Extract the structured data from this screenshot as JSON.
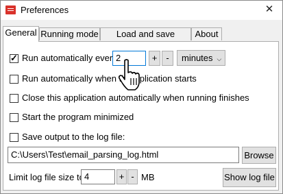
{
  "window": {
    "title": "Preferences",
    "close_glyph": "✕"
  },
  "tabs": [
    {
      "label": "General"
    },
    {
      "label": "Running mode"
    },
    {
      "label": "Load and save settings"
    },
    {
      "label": "About"
    }
  ],
  "general": {
    "run_every": {
      "label": "Run automatically every",
      "value": "2",
      "plus": "+",
      "minus": "-",
      "unit": "minutes",
      "checked": true
    },
    "run_on_start": {
      "label": "Run automatically when th",
      "label_tail": "pplication starts",
      "checked": false
    },
    "close_when_done": {
      "label": "Close this application automatically when running finishes",
      "checked": false
    },
    "start_minimized": {
      "label": "Start the program minimized",
      "checked": false
    },
    "save_log": {
      "label": "Save output to the log file:",
      "checked": false
    },
    "log_path": {
      "value": "C:\\Users\\Test\\email_parsing_log.html"
    },
    "browse_label": "Browse",
    "limit": {
      "label": "Limit log file size to",
      "value": "4",
      "plus": "+",
      "minus": "-",
      "unit": "MB"
    },
    "show_log_label": "Show log file"
  },
  "colors": {
    "accent": "#0078d7",
    "app_icon": "#d9322b"
  },
  "icons": {
    "cursor": "hand-pointer-icon",
    "app": "app-logo-icon"
  }
}
